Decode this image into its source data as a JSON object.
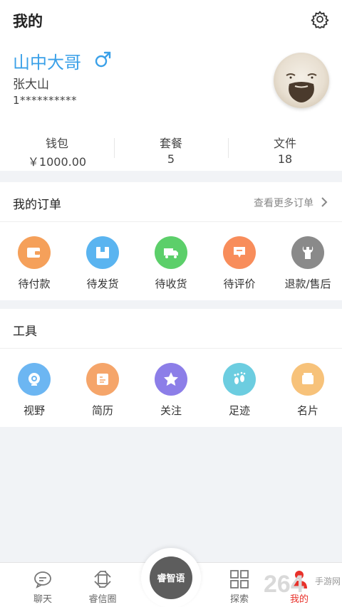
{
  "header": {
    "title": "我的"
  },
  "profile": {
    "nickname": "山中大哥",
    "gender_symbol": "♂",
    "real_name": "张大山",
    "phone": "1**********"
  },
  "stats": [
    {
      "label": "钱包",
      "value": "￥1000.00"
    },
    {
      "label": "套餐",
      "value": "5"
    },
    {
      "label": "文件",
      "value": "18"
    }
  ],
  "orders": {
    "title": "我的订单",
    "more_label": "查看更多订单",
    "items": [
      {
        "label": "待付款",
        "icon": "wallet-icon",
        "color": "#f5a05a"
      },
      {
        "label": "待发货",
        "icon": "box-icon",
        "color": "#5ab4f0"
      },
      {
        "label": "待收货",
        "icon": "truck-icon",
        "color": "#5ccf6a"
      },
      {
        "label": "待评价",
        "icon": "comment-icon",
        "color": "#f88d5b"
      },
      {
        "label": "退款/售后",
        "icon": "wrench-icon",
        "color": "#8a8a8a"
      }
    ]
  },
  "tools": {
    "title": "工具",
    "items": [
      {
        "label": "视野",
        "icon": "camera-icon",
        "color": "#6cb6f2"
      },
      {
        "label": "简历",
        "icon": "resume-icon",
        "color": "#f5a56a"
      },
      {
        "label": "关注",
        "icon": "star-icon",
        "color": "#8c7ee8"
      },
      {
        "label": "足迹",
        "icon": "footprint-icon",
        "color": "#6ccde0"
      },
      {
        "label": "名片",
        "icon": "card-icon",
        "color": "#f7c27a"
      }
    ]
  },
  "tabbar": {
    "items": [
      {
        "label": "聊天",
        "icon": "chat-icon"
      },
      {
        "label": "睿信圈",
        "icon": "moments-icon"
      },
      {
        "label": "探索",
        "icon": "grid-icon"
      },
      {
        "label": "我的",
        "icon": "user-icon",
        "color": "#e8312a"
      }
    ],
    "center_label": "睿智语"
  },
  "watermark": {
    "number": "264",
    "text": "手游网"
  }
}
